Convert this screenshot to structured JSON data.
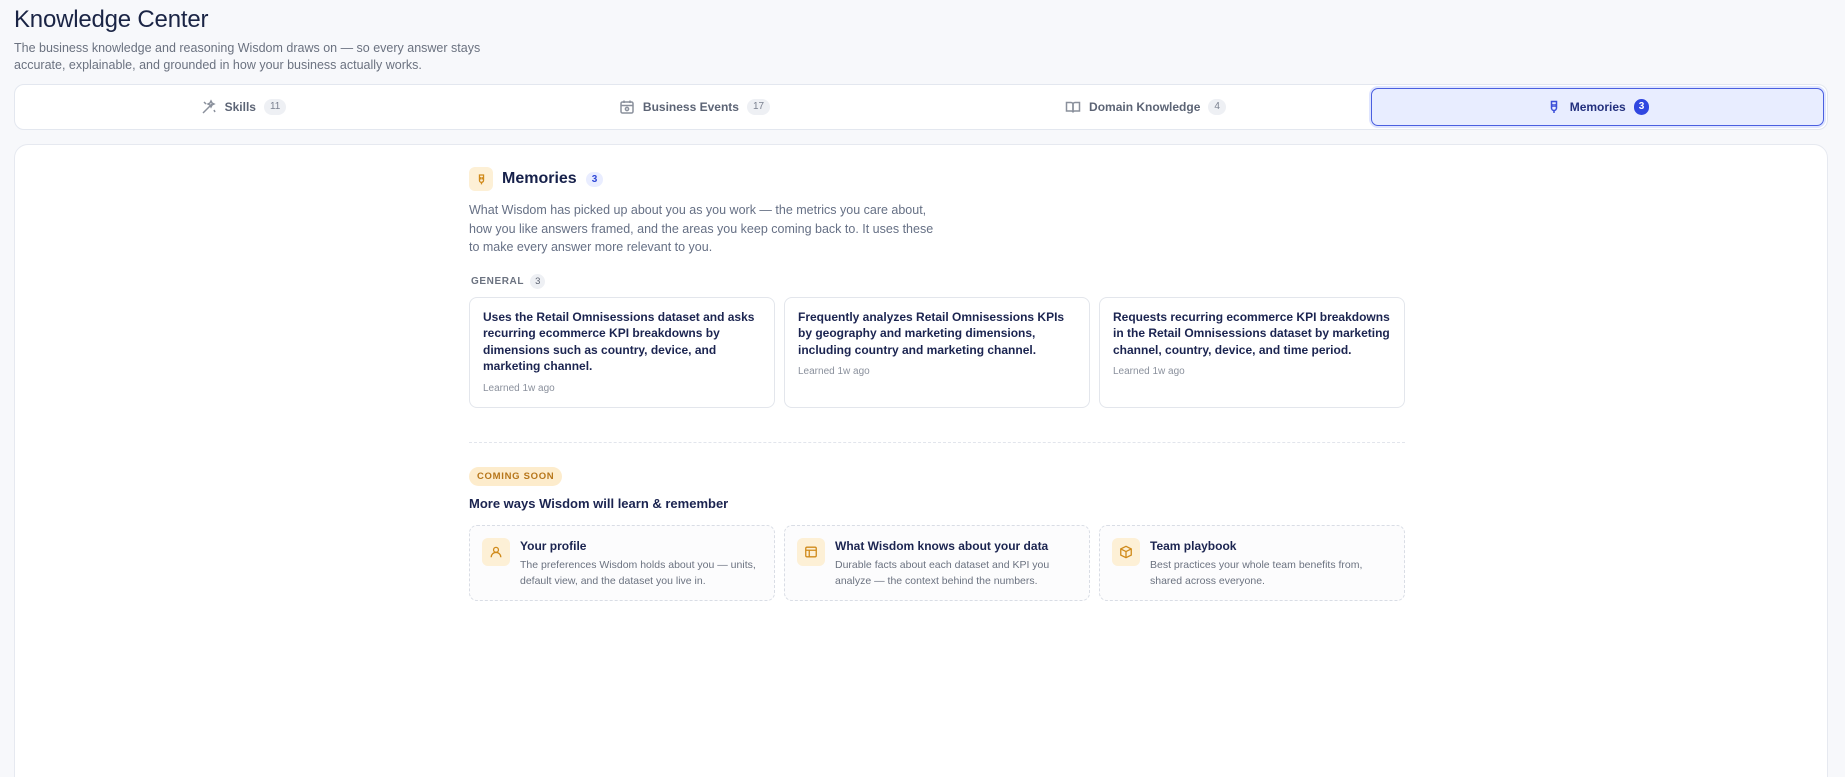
{
  "header": {
    "title": "Knowledge Center",
    "subtitle": "The business knowledge and reasoning Wisdom draws on — so every answer stays accurate, explainable, and grounded in how your business actually works."
  },
  "tabs": [
    {
      "label": "Skills",
      "count": "11",
      "icon": "wand-icon",
      "active": false
    },
    {
      "label": "Business Events",
      "count": "17",
      "icon": "calendar-icon",
      "active": false
    },
    {
      "label": "Domain Knowledge",
      "count": "4",
      "icon": "book-icon",
      "active": false
    },
    {
      "label": "Memories",
      "count": "3",
      "icon": "memory-icon",
      "active": true
    }
  ],
  "memories": {
    "title": "Memories",
    "count": "3",
    "description": "What Wisdom has picked up about you as you work — the metrics you care about, how you like answers framed, and the areas you keep coming back to. It uses these to make every answer more relevant to you.",
    "group": {
      "label": "GENERAL",
      "count": "3"
    },
    "items": [
      {
        "text": "Uses the Retail Omnisessions dataset and asks recurring ecommerce KPI breakdowns by dimensions such as country, device, and marketing channel.",
        "meta": "Learned 1w ago"
      },
      {
        "text": "Frequently analyzes Retail Omnisessions KPIs by geography and marketing dimensions, including country and marketing channel.",
        "meta": "Learned 1w ago"
      },
      {
        "text": "Requests recurring ecommerce KPI breakdowns in the Retail Omnisessions dataset by marketing channel, country, device, and time period.",
        "meta": "Learned 1w ago"
      }
    ]
  },
  "coming_soon": {
    "badge": "COMING SOON",
    "title": "More ways Wisdom will learn & remember",
    "items": [
      {
        "title": "Your profile",
        "desc": "The preferences Wisdom holds about you — units, default view, and the dataset you live in.",
        "icon": "user-icon"
      },
      {
        "title": "What Wisdom knows about your data",
        "desc": "Durable facts about each dataset and KPI you analyze — the context behind the numbers.",
        "icon": "table-icon"
      },
      {
        "title": "Team playbook",
        "desc": "Best practices your whole team benefits from, shared across everyone.",
        "icon": "box-icon"
      }
    ]
  },
  "colors": {
    "accent": "#3047e0",
    "warm": "#d08a1a",
    "text": "#1b2450"
  }
}
